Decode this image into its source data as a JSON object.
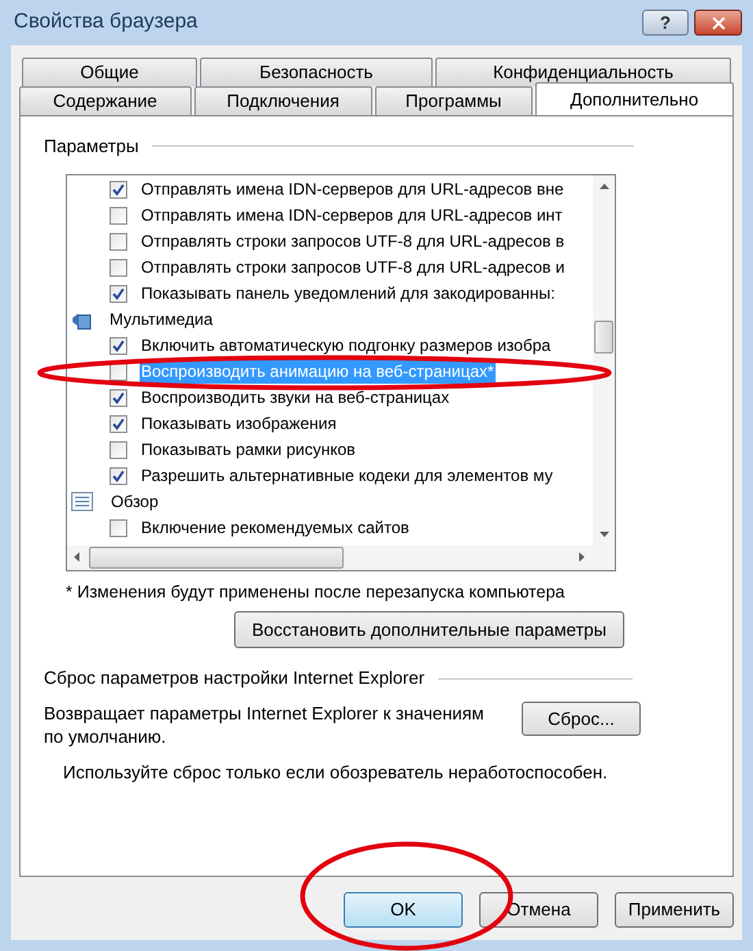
{
  "window": {
    "title": "Свойства браузера",
    "help_button": "?"
  },
  "tabs_back": [
    {
      "label": "Общие",
      "selected": false
    },
    {
      "label": "Безопасность",
      "selected": false
    },
    {
      "label": "Конфиденциальность",
      "selected": false
    }
  ],
  "tabs_front": [
    {
      "label": "Содержание",
      "selected": false
    },
    {
      "label": "Подключения",
      "selected": false
    },
    {
      "label": "Программы",
      "selected": false
    },
    {
      "label": "Дополнительно",
      "selected": true
    }
  ],
  "settings": {
    "title": "Параметры",
    "items": [
      {
        "kind": "checkbox",
        "label": "Отправлять имена IDN-серверов для URL-адресов вне",
        "checked": true,
        "selected": false
      },
      {
        "kind": "checkbox",
        "label": "Отправлять имена IDN-серверов для URL-адресов инт",
        "checked": false,
        "selected": false
      },
      {
        "kind": "checkbox",
        "label": "Отправлять строки запросов UTF-8 для URL-адресов в",
        "checked": false,
        "selected": false
      },
      {
        "kind": "checkbox",
        "label": "Отправлять строки запросов UTF-8 для URL-адресов и",
        "checked": false,
        "selected": false
      },
      {
        "kind": "checkbox",
        "label": "Показывать панель уведомлений для закодированны:",
        "checked": true,
        "selected": false
      },
      {
        "kind": "category",
        "label": "Мультимедиа"
      },
      {
        "kind": "checkbox",
        "label": "Включить автоматическую подгонку размеров изобра",
        "checked": true,
        "selected": false
      },
      {
        "kind": "checkbox",
        "label": "Воспроизводить анимацию на веб-страницах*",
        "checked": false,
        "selected": true
      },
      {
        "kind": "checkbox",
        "label": "Воспроизводить звуки на веб-страницах",
        "checked": true,
        "selected": false
      },
      {
        "kind": "checkbox",
        "label": "Показывать изображения",
        "checked": true,
        "selected": false
      },
      {
        "kind": "checkbox",
        "label": "Показывать рамки рисунков",
        "checked": false,
        "selected": false
      },
      {
        "kind": "checkbox",
        "label": "Разрешить альтернативные кодеки для элементов му",
        "checked": true,
        "selected": false
      },
      {
        "kind": "category",
        "label": "Обзор"
      },
      {
        "kind": "checkbox",
        "label": "Включение рекомендуемых сайтов",
        "checked": false,
        "selected": false
      }
    ],
    "note": "* Изменения будут применены после перезапуска компьютера",
    "restore_button": "Восстановить дополнительные параметры"
  },
  "reset": {
    "title": "Сброс параметров настройки Internet Explorer",
    "description": "Возвращает параметры Internet Explorer к значениям по умолчанию.",
    "button": "Сброс...",
    "warning": "Используйте сброс только если обозреватель неработоспособен."
  },
  "buttons": [
    {
      "label": "OK",
      "default": true
    },
    {
      "label": "Отмена",
      "default": false
    },
    {
      "label": "Применить",
      "default": false
    }
  ]
}
